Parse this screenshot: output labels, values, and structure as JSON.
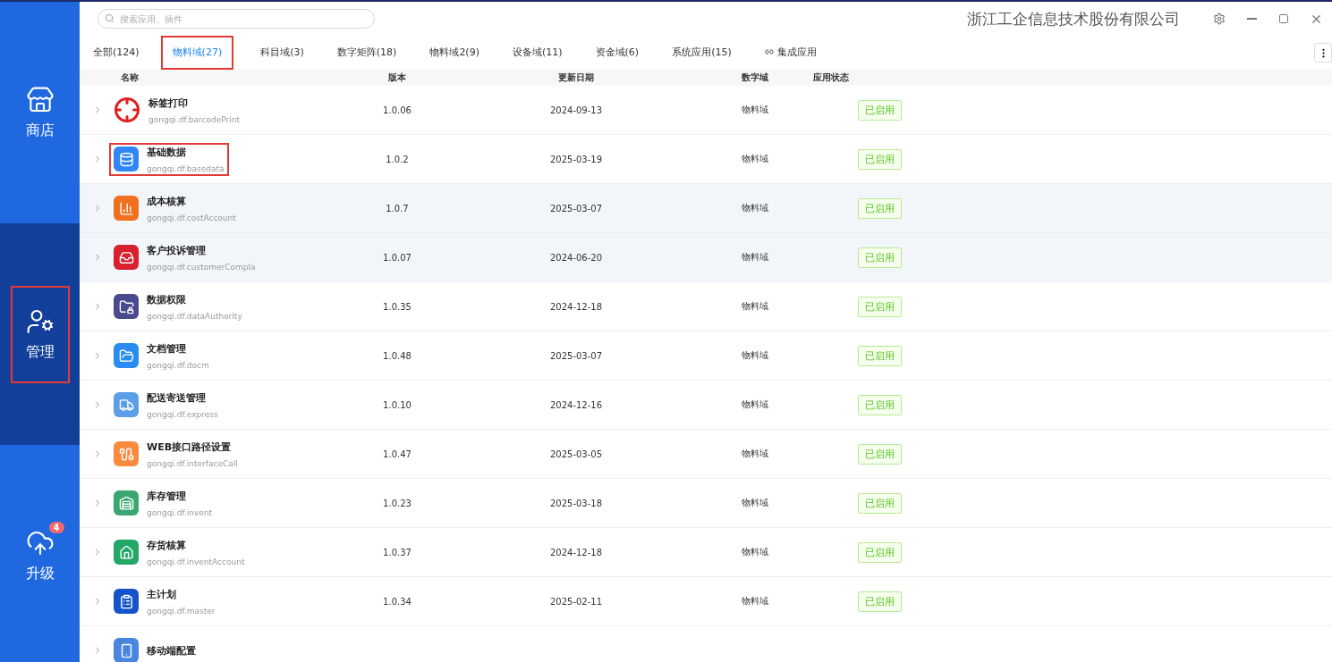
{
  "sidebar": {
    "items": [
      {
        "label": "商店",
        "selected": false,
        "highlighted": false
      },
      {
        "label": "管理",
        "selected": true,
        "highlighted": true
      },
      {
        "label": "升级",
        "selected": false,
        "highlighted": false,
        "badge": "4"
      }
    ]
  },
  "search": {
    "placeholder": "搜索应用、插件"
  },
  "window": {
    "title": "浙江工企信息技术股份有限公司"
  },
  "tabs": [
    {
      "label": "全部(124)",
      "selected": false,
      "highlighted": false
    },
    {
      "label": "物料域(27)",
      "selected": true,
      "highlighted": true
    },
    {
      "label": "科目域(3)",
      "selected": false,
      "highlighted": false
    },
    {
      "label": "数字矩阵(18)",
      "selected": false,
      "highlighted": false
    },
    {
      "label": "物料域2(9)",
      "selected": false,
      "highlighted": false
    },
    {
      "label": "设备域(11)",
      "selected": false,
      "highlighted": false
    },
    {
      "label": "资金域(6)",
      "selected": false,
      "highlighted": false
    },
    {
      "label": "系统应用(15)",
      "selected": false,
      "highlighted": false
    },
    {
      "label": "集成应用",
      "selected": false,
      "highlighted": false,
      "kind": "link"
    }
  ],
  "table": {
    "columns": [
      "名称",
      "版本",
      "更新日期",
      "数字域",
      "应用状态"
    ],
    "rows": [
      {
        "name": "标签打印",
        "id": "gongqi.df.barcodePrint",
        "version": "1.0.06",
        "date": "2024-09-13",
        "domain": "物料域",
        "status": "已启用",
        "kind": "outline",
        "color": "#e02020",
        "shaded": false,
        "highlighted": false
      },
      {
        "name": "基础数据",
        "id": "gongqi.df.basedata",
        "version": "1.0.2",
        "date": "2025-03-19",
        "domain": "物料域",
        "status": "已启用",
        "kind": "tile",
        "color": "#2f86f6",
        "shaded": false,
        "highlighted": true
      },
      {
        "name": "成本核算",
        "id": "gongqi.df.costAccount",
        "version": "1.0.7",
        "date": "2025-03-07",
        "domain": "物料域",
        "status": "已启用",
        "kind": "tile",
        "color": "#f0701e",
        "shaded": true,
        "highlighted": false
      },
      {
        "name": "客户投诉管理",
        "id": "gongqi.df.customerCompla",
        "version": "1.0.07",
        "date": "2024-06-20",
        "domain": "物料域",
        "status": "已启用",
        "kind": "tile",
        "color": "#d8202e",
        "shaded": true,
        "highlighted": false
      },
      {
        "name": "数据权限",
        "id": "gongqi.df.dataAuthority",
        "version": "1.0.35",
        "date": "2024-12-18",
        "domain": "物料域",
        "status": "已启用",
        "kind": "tile",
        "color": "#4a4a8e",
        "shaded": false,
        "highlighted": false
      },
      {
        "name": "文档管理",
        "id": "gongqi.df.docm",
        "version": "1.0.48",
        "date": "2025-03-07",
        "domain": "物料域",
        "status": "已启用",
        "kind": "tile",
        "color": "#2a8cf0",
        "shaded": false,
        "highlighted": false
      },
      {
        "name": "配送寄送管理",
        "id": "gongqi.df.express",
        "version": "1.0.10",
        "date": "2024-12-16",
        "domain": "物料域",
        "status": "已启用",
        "kind": "tile",
        "color": "#5c9ee8",
        "shaded": false,
        "highlighted": false
      },
      {
        "name": "WEB接口路径设置",
        "id": "gongqi.df.interfaceCall",
        "version": "1.0.47",
        "date": "2025-03-05",
        "domain": "物料域",
        "status": "已启用",
        "kind": "tile",
        "color": "#fa8a3c",
        "shaded": false,
        "highlighted": false
      },
      {
        "name": "库存管理",
        "id": "gongqi.df.invent",
        "version": "1.0.23",
        "date": "2025-03-18",
        "domain": "物料域",
        "status": "已启用",
        "kind": "tile",
        "color": "#3aa772",
        "shaded": false,
        "highlighted": false
      },
      {
        "name": "存货核算",
        "id": "gongqi.df.inventAccount",
        "version": "1.0.37",
        "date": "2024-12-18",
        "domain": "物料域",
        "status": "已启用",
        "kind": "tile",
        "color": "#22a768",
        "shaded": false,
        "highlighted": false
      },
      {
        "name": "主计划",
        "id": "gongqi.df.master",
        "version": "1.0.34",
        "date": "2025-02-11",
        "domain": "物料域",
        "status": "已启用",
        "kind": "tile",
        "color": "#1554c8",
        "shaded": false,
        "highlighted": false
      },
      {
        "name": "移动端配置",
        "kind": "tile",
        "color": "#4a86e0",
        "shaded": false,
        "highlighted": false
      }
    ]
  }
}
